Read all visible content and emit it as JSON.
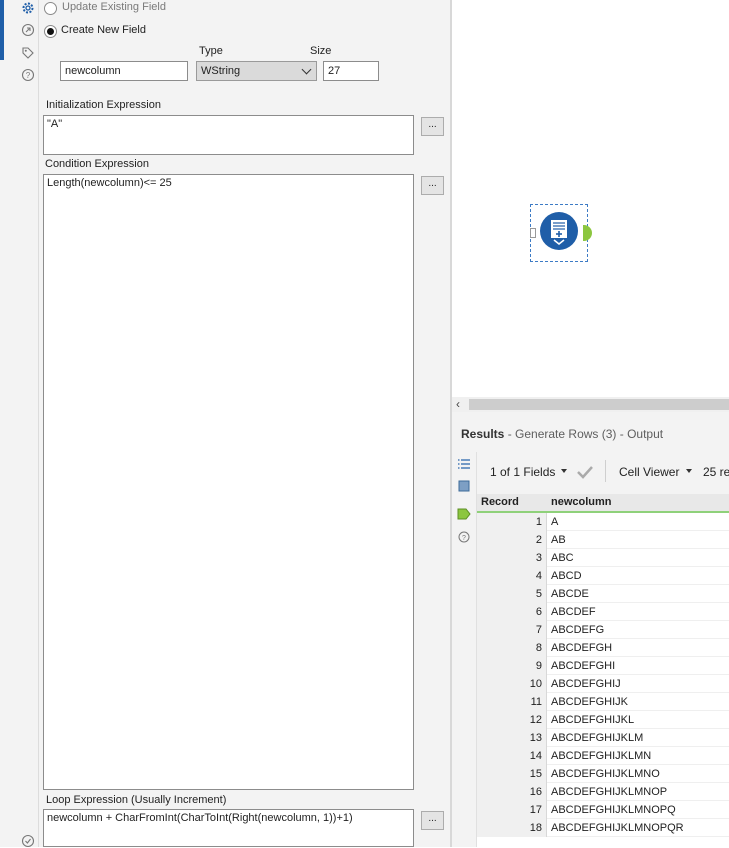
{
  "config": {
    "update_label": "Update Existing Field",
    "create_label": "Create New  Field",
    "type_label": "Type",
    "size_label": "Size",
    "field_name": "newcolumn",
    "type_value": "WString",
    "size_value": "27",
    "init_label": "Initialization Expression",
    "init_value": "\"A\"",
    "cond_label": "Condition Expression",
    "cond_value": "Length(newcolumn)<= 25",
    "loop_label": "Loop Expression (Usually Increment)",
    "loop_value": "newcolumn + CharFromInt(CharToInt(Right(newcolumn, 1))+1)",
    "dots": "..."
  },
  "results": {
    "title": "Results",
    "subtitle": "- Generate Rows (3) - Output",
    "fields": "1 of 1 Fields",
    "viewer": "Cell Viewer",
    "count_partial": "25 re",
    "col_record": "Record",
    "col_name": "newcolumn",
    "rows": [
      {
        "n": "1",
        "v": "A"
      },
      {
        "n": "2",
        "v": "AB"
      },
      {
        "n": "3",
        "v": "ABC"
      },
      {
        "n": "4",
        "v": "ABCD"
      },
      {
        "n": "5",
        "v": "ABCDE"
      },
      {
        "n": "6",
        "v": "ABCDEF"
      },
      {
        "n": "7",
        "v": "ABCDEFG"
      },
      {
        "n": "8",
        "v": "ABCDEFGH"
      },
      {
        "n": "9",
        "v": "ABCDEFGHI"
      },
      {
        "n": "10",
        "v": "ABCDEFGHIJ"
      },
      {
        "n": "11",
        "v": "ABCDEFGHIJK"
      },
      {
        "n": "12",
        "v": "ABCDEFGHIJKL"
      },
      {
        "n": "13",
        "v": "ABCDEFGHIJKLM"
      },
      {
        "n": "14",
        "v": "ABCDEFGHIJKLMN"
      },
      {
        "n": "15",
        "v": "ABCDEFGHIJKLMNO"
      },
      {
        "n": "16",
        "v": "ABCDEFGHIJKLMNOP"
      },
      {
        "n": "17",
        "v": "ABCDEFGHIJKLMNOPQ"
      },
      {
        "n": "18",
        "v": "ABCDEFGHIJKLMNOPQR"
      }
    ]
  },
  "colors": {
    "accent": "#1f5ea8",
    "anchor_green": "#8cc63f",
    "select_dashed": "#3d7bc5"
  }
}
